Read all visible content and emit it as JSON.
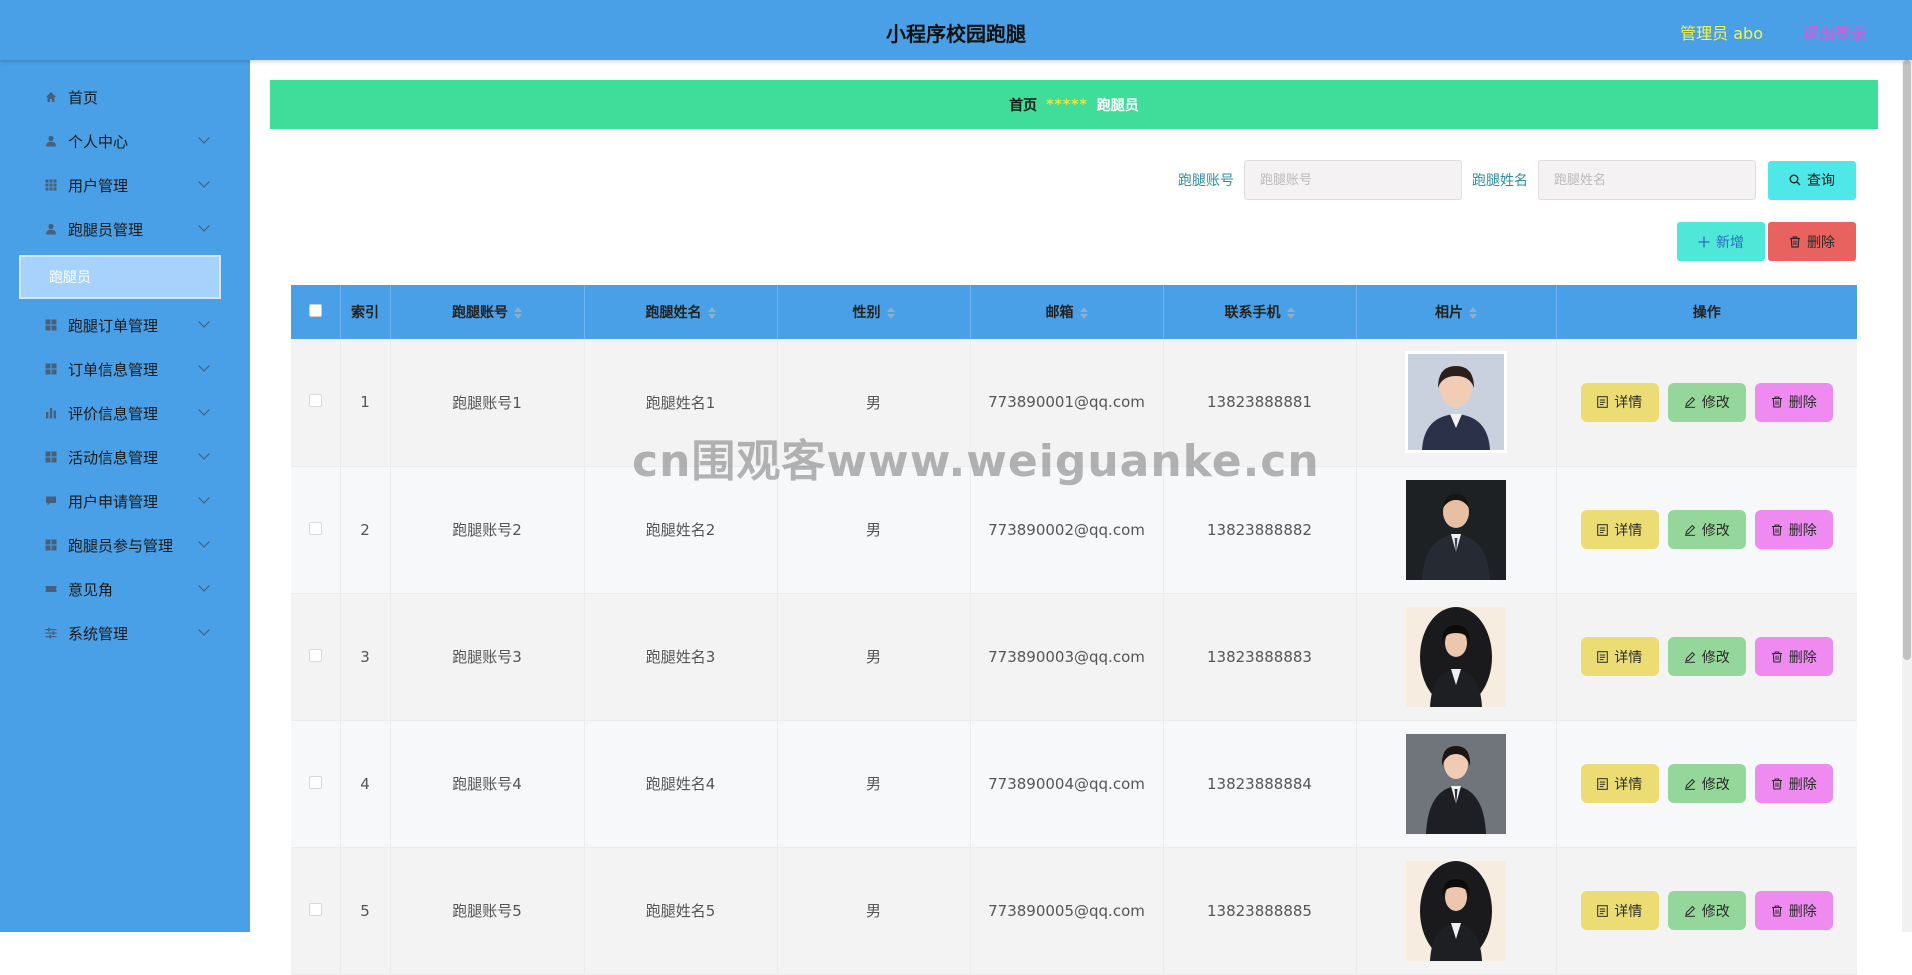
{
  "header": {
    "title": "小程序校园跑腿",
    "admin": "管理员 abo",
    "logout": "退出登录"
  },
  "sidebar": {
    "items": [
      {
        "label": "首页",
        "icon": "home-icon"
      },
      {
        "label": "个人中心",
        "icon": "user-icon"
      },
      {
        "label": "用户管理",
        "icon": "grid-icon"
      },
      {
        "label": "跑腿员管理",
        "icon": "user-icon"
      },
      {
        "label": "跑腿订单管理",
        "icon": "grid-icon"
      },
      {
        "label": "订单信息管理",
        "icon": "grid-icon"
      },
      {
        "label": "评价信息管理",
        "icon": "bar-chart-icon"
      },
      {
        "label": "活动信息管理",
        "icon": "grid-icon"
      },
      {
        "label": "用户申请管理",
        "icon": "chat-icon"
      },
      {
        "label": "跑腿员参与管理",
        "icon": "grid-icon"
      },
      {
        "label": "意见角",
        "icon": "ticket-icon"
      },
      {
        "label": "系统管理",
        "icon": "sliders-icon"
      }
    ],
    "active_sub": "跑腿员"
  },
  "breadcrumb": {
    "home": "首页",
    "separator": "*****",
    "current": "跑腿员"
  },
  "search": {
    "account_label": "跑腿账号",
    "account_placeholder": "跑腿账号",
    "name_label": "跑腿姓名",
    "name_placeholder": "跑腿姓名",
    "query_button": "查询"
  },
  "actions": {
    "add": "新增",
    "delete": "删除"
  },
  "table": {
    "headers": {
      "index": "索引",
      "account": "跑腿账号",
      "name": "跑腿姓名",
      "gender": "性别",
      "email": "邮箱",
      "phone": "联系手机",
      "photo": "相片",
      "ops": "操作"
    },
    "ops": {
      "detail": "详情",
      "edit": "修改",
      "delete": "删除"
    },
    "rows": [
      {
        "index": "1",
        "account": "跑腿账号1",
        "name": "跑腿姓名1",
        "gender": "男",
        "email": "773890001@qq.com",
        "phone": "13823888881"
      },
      {
        "index": "2",
        "account": "跑腿账号2",
        "name": "跑腿姓名2",
        "gender": "男",
        "email": "773890002@qq.com",
        "phone": "13823888882"
      },
      {
        "index": "3",
        "account": "跑腿账号3",
        "name": "跑腿姓名3",
        "gender": "男",
        "email": "773890003@qq.com",
        "phone": "13823888883"
      },
      {
        "index": "4",
        "account": "跑腿账号4",
        "name": "跑腿姓名4",
        "gender": "男",
        "email": "773890004@qq.com",
        "phone": "13823888884"
      },
      {
        "index": "5",
        "account": "跑腿账号5",
        "name": "跑腿姓名5",
        "gender": "男",
        "email": "773890005@qq.com",
        "phone": "13823888885"
      }
    ]
  },
  "watermark": "cn围观客www.weiguanke.cn",
  "colors": {
    "header": "#4aa0e6",
    "breadcrumb": "#3fdc9a",
    "detail": "#ebdd74",
    "edit": "#95d69a",
    "delete": "#ef8bf0"
  }
}
